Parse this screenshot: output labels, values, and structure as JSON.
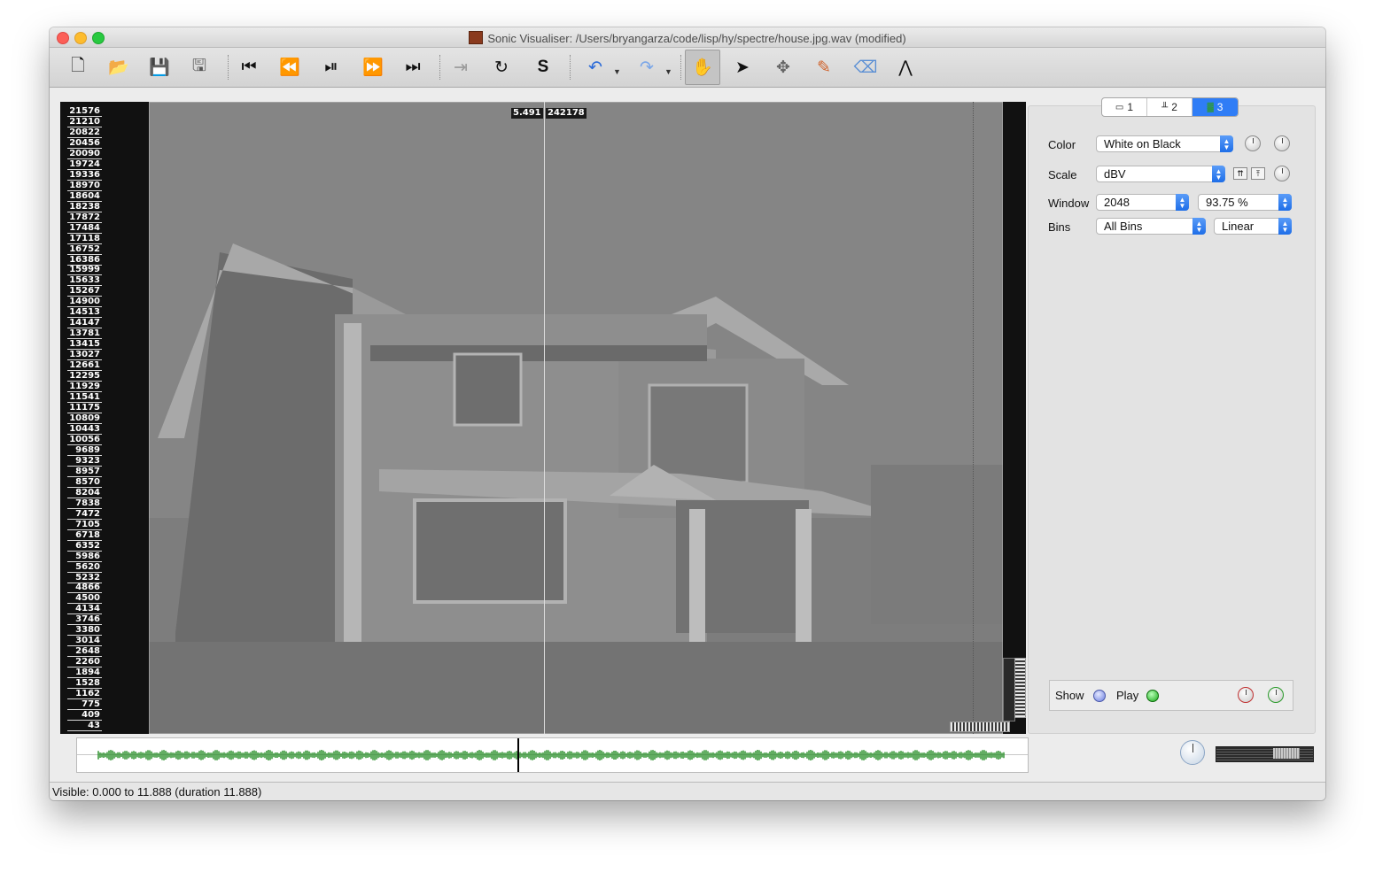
{
  "window": {
    "title": "Sonic Visualiser: /Users/bryangarza/code/lisp/hy/spectre/house.jpg.wav (modified)"
  },
  "toolbar": {
    "buttons": [
      {
        "name": "new-icon",
        "glyph": "🗋"
      },
      {
        "name": "open-icon",
        "glyph": "📂"
      },
      {
        "name": "save-icon",
        "glyph": "💾"
      },
      {
        "name": "save-session-icon",
        "glyph": "🖫"
      },
      {
        "name": "rewind-start-icon",
        "glyph": "⏮"
      },
      {
        "name": "rewind-icon",
        "glyph": "⏪"
      },
      {
        "name": "play-pause-icon",
        "glyph": "⏯"
      },
      {
        "name": "fast-forward-icon",
        "glyph": "⏩"
      },
      {
        "name": "fast-forward-end-icon",
        "glyph": "⏭"
      },
      {
        "name": "constrain-playback-icon",
        "glyph": "⇥"
      },
      {
        "name": "loop-icon",
        "glyph": "↻"
      },
      {
        "name": "solo-icon",
        "glyph": "S"
      },
      {
        "name": "undo-icon",
        "glyph": "↶"
      },
      {
        "name": "redo-icon",
        "glyph": "↷"
      },
      {
        "name": "navigate-tool-icon",
        "glyph": "✋"
      },
      {
        "name": "select-tool-icon",
        "glyph": "➤"
      },
      {
        "name": "move-tool-icon",
        "glyph": "✥"
      },
      {
        "name": "draw-tool-icon",
        "glyph": "✎"
      },
      {
        "name": "erase-tool-icon",
        "glyph": "⌫"
      },
      {
        "name": "measure-tool-icon",
        "glyph": "⋀"
      }
    ]
  },
  "pane": {
    "frequency_scale": [
      "21576",
      "21210",
      "20822",
      "20456",
      "20090",
      "19724",
      "19336",
      "18970",
      "18604",
      "18238",
      "17872",
      "17484",
      "17118",
      "16752",
      "16386",
      "15999",
      "15633",
      "15267",
      "14900",
      "14513",
      "14147",
      "13781",
      "13415",
      "13027",
      "12661",
      "12295",
      "11929",
      "11541",
      "11175",
      "10809",
      "10443",
      "10056",
      "9689",
      "9323",
      "8957",
      "8570",
      "8204",
      "7838",
      "7472",
      "7105",
      "6718",
      "6352",
      "5986",
      "5620",
      "5232",
      "4866",
      "4500",
      "4134",
      "3746",
      "3380",
      "3014",
      "2648",
      "2260",
      "1894",
      "1528",
      "1162",
      "775",
      "409",
      "43"
    ],
    "cursor_time": "5.491",
    "cursor_frame": "242178"
  },
  "properties": {
    "tabs": [
      {
        "label": "1",
        "icon": "waveform-layer-icon"
      },
      {
        "label": "2",
        "icon": "spectrum-layer-icon"
      },
      {
        "label": "3",
        "icon": "spectrogram-layer-icon",
        "active": true
      }
    ],
    "color_label": "Color",
    "color_value": "White on Black",
    "scale_label": "Scale",
    "scale_value": "dBV",
    "window_label": "Window",
    "window_value": "2048",
    "overlap_value": "93.75 %",
    "bins_label": "Bins",
    "bins_value": "All Bins",
    "bins_scale_value": "Linear",
    "show_label": "Show",
    "play_label": "Play"
  },
  "status": {
    "text": "Visible: 0.000 to 11.888 (duration 11.888)"
  },
  "colors": {
    "accent": "#2f7df6",
    "waveform": "#1f8a1f",
    "spectrogram_bg": "#858585"
  }
}
